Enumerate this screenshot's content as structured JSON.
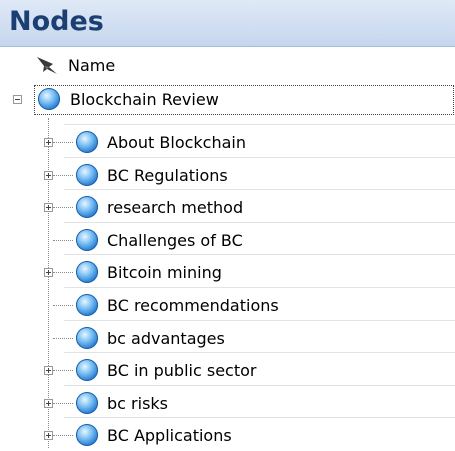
{
  "panel": {
    "title": "Nodes"
  },
  "column": {
    "name_label": "Name",
    "icon": "pushpin-icon"
  },
  "root": {
    "label": "Blockchain Review",
    "expanded": true
  },
  "children": [
    {
      "label": "About Blockchain",
      "expandable": true
    },
    {
      "label": "BC Regulations",
      "expandable": true
    },
    {
      "label": "research method",
      "expandable": true
    },
    {
      "label": "Challenges of BC",
      "expandable": false
    },
    {
      "label": "Bitcoin mining",
      "expandable": true
    },
    {
      "label": "BC recommendations",
      "expandable": false
    },
    {
      "label": "bc advantages",
      "expandable": false
    },
    {
      "label": "BC in public sector",
      "expandable": true
    },
    {
      "label": "bc risks",
      "expandable": true
    },
    {
      "label": "BC Applications",
      "expandable": true
    }
  ],
  "colors": {
    "title": "#1b3f73",
    "header_bg": "#c6d6ee",
    "node_icon": "#2a7fd4"
  }
}
